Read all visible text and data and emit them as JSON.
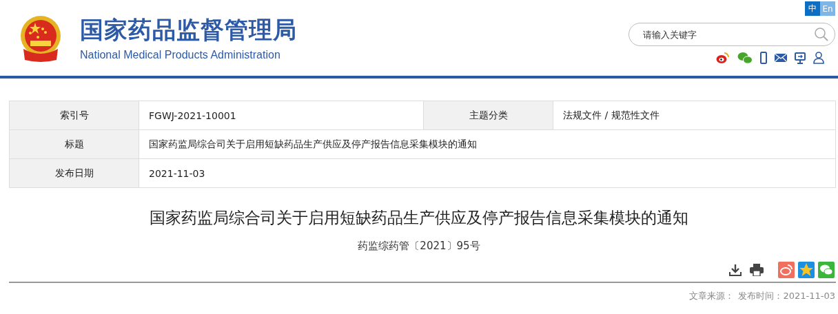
{
  "site": {
    "title": "国家药品监督管理局",
    "subtitle": "National Medical Products Administration"
  },
  "languages": [
    {
      "label": "中",
      "selected": true
    },
    {
      "label": "En",
      "selected": false
    }
  ],
  "search": {
    "placeholder": "请输入关键字"
  },
  "meta": [
    {
      "fields": [
        {
          "label": "索引号",
          "value": "FGWJ-2021-10001"
        },
        {
          "label": "主题分类",
          "value": "法规文件 / 规范性文件"
        }
      ]
    },
    {
      "fields": [
        {
          "label": "标题",
          "value": "国家药监局综合司关于启用短缺药品生产供应及停产报告信息采集模块的通知"
        }
      ]
    },
    {
      "fields": [
        {
          "label": "发布日期",
          "value": "2021-11-03"
        }
      ]
    }
  ],
  "article": {
    "title": "国家药监局综合司关于启用短缺药品生产供应及停产报告信息采集模块的通知",
    "doc_number": "药监综药管〔2021〕95号",
    "source": "文章来源：",
    "published": "发布时间：2021-11-03"
  }
}
